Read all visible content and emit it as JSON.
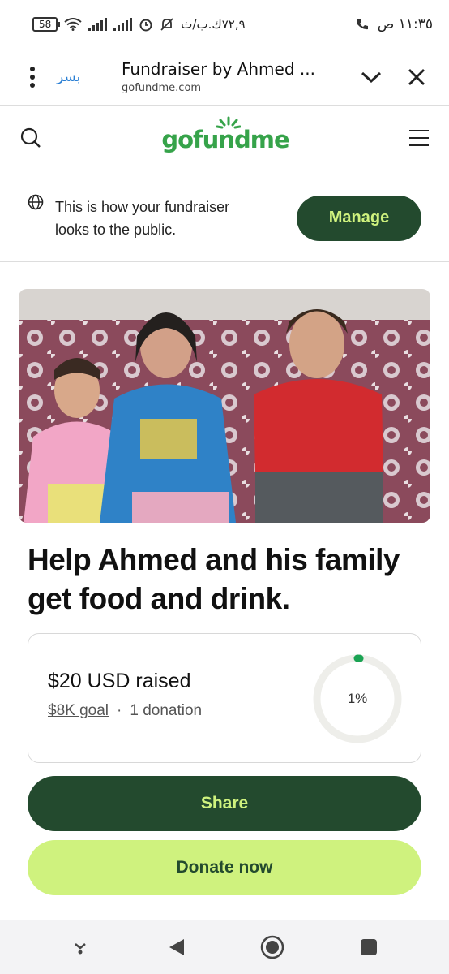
{
  "status_bar": {
    "time": "١١:٣٥ ص",
    "data_speed": "٧٢,٩ك.ب/ث",
    "battery": "58"
  },
  "browser": {
    "tab_owner": "بسر",
    "page_title": "Fundraiser by Ahmed ...",
    "url": "gofundme.com",
    "icons": [
      "menu-dots-icon",
      "chevron-down-icon",
      "close-icon"
    ]
  },
  "site_header": {
    "logo": "gofundme",
    "icons": [
      "search-icon",
      "hamburger-menu-icon"
    ]
  },
  "notice": {
    "text": "This is how your fundraiser looks to the public.",
    "manage_label": "Manage"
  },
  "fundraiser": {
    "title": "Help Ahmed and his family get food and drink.",
    "raised": "$20 USD raised",
    "goal": "$8K goal",
    "separator": "·",
    "donations": "1 donation",
    "progress_label": "1%",
    "progress_fraction": 0.01
  },
  "actions": {
    "share_label": "Share",
    "donate_label": "Donate now"
  },
  "colors": {
    "brand_green": "#36a34a",
    "dark_green": "#234a2e",
    "lime": "#cff27e",
    "progress_green": "#1aa353"
  }
}
